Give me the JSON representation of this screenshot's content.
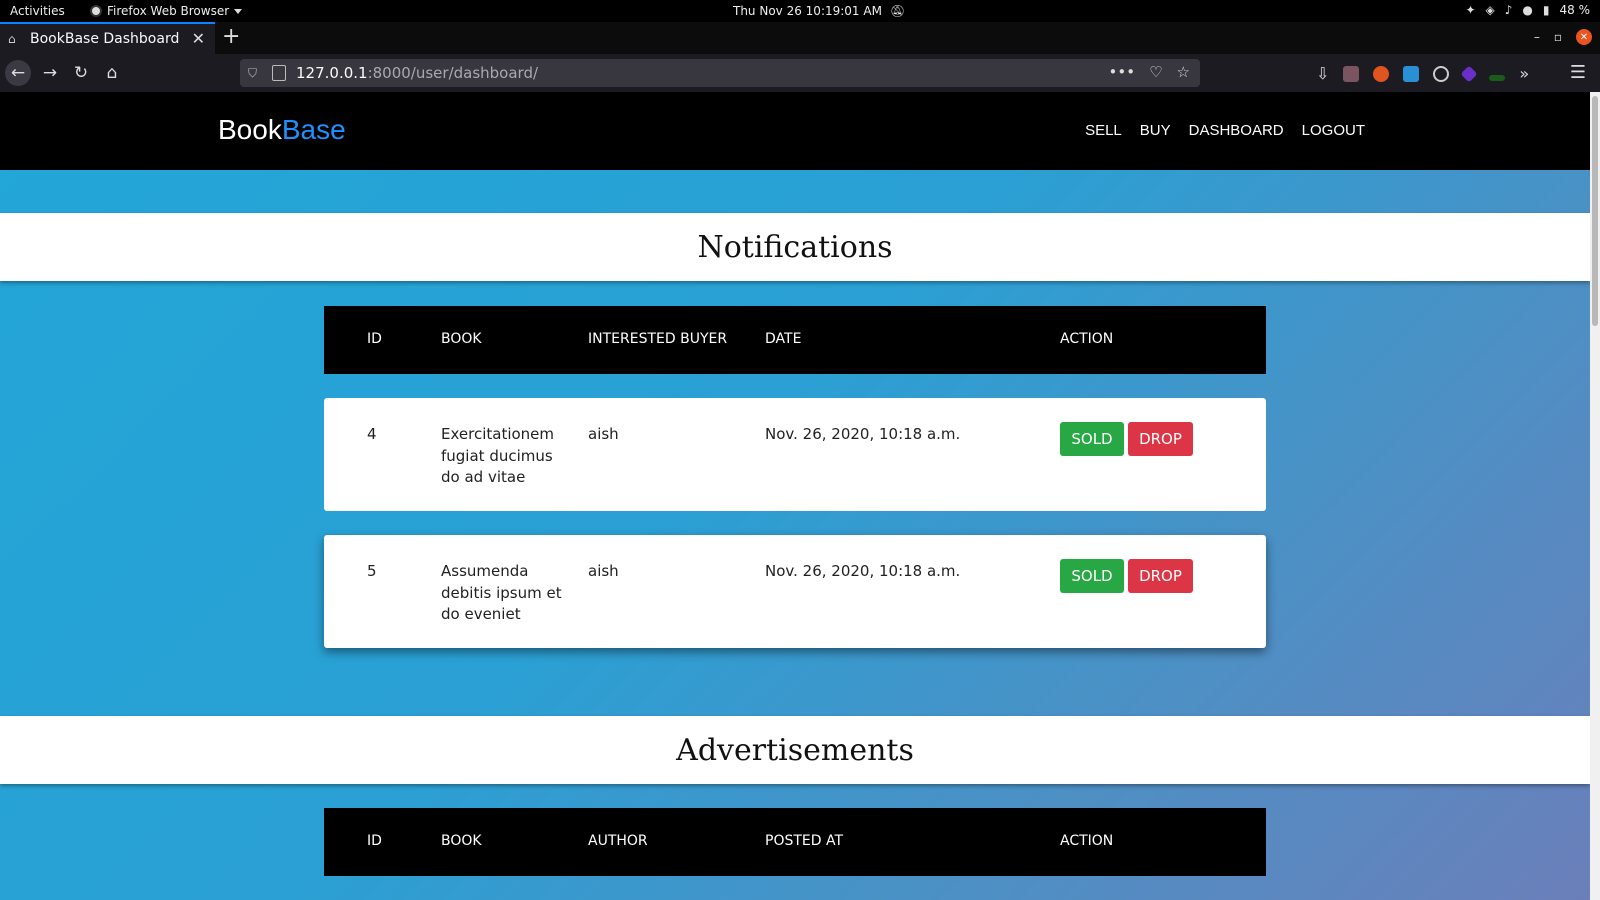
{
  "os_bar": {
    "activities": "Activities",
    "app_name": "Firefox Web Browser",
    "clock": "Thu Nov 26  10:19:01 AM",
    "battery": "48 %"
  },
  "browser": {
    "tab_title": "BookBase Dashboard",
    "url_host": "127.0.0.1",
    "url_rest": ":8000/user/dashboard/"
  },
  "site": {
    "brand_part1": "Book",
    "brand_part2": "Base",
    "brand_accent_color": "#1e90ff",
    "nav": [
      "SELL",
      "BUY",
      "DASHBOARD",
      "LOGOUT"
    ]
  },
  "notifications": {
    "title": "Notifications",
    "headers": [
      "ID",
      "BOOK",
      "INTERESTED BUYER",
      "DATE",
      "ACTION"
    ],
    "rows": [
      {
        "id": "4",
        "book": "Exercitationem fugiat ducimus do ad vitae",
        "buyer": "aish",
        "date": "Nov. 26, 2020, 10:18 a.m.",
        "sold": "SOLD",
        "drop": "DROP"
      },
      {
        "id": "5",
        "book": "Assumenda debitis ipsum et do eveniet",
        "buyer": "aish",
        "date": "Nov. 26, 2020, 10:18 a.m.",
        "sold": "SOLD",
        "drop": "DROP"
      }
    ]
  },
  "advertisements": {
    "title": "Advertisements",
    "headers": [
      "ID",
      "BOOK",
      "AUTHOR",
      "POSTED AT",
      "ACTION"
    ]
  },
  "colors": {
    "sold": "#28a745",
    "drop": "#dc3545",
    "gradient_start": "#22a6d8",
    "gradient_end": "#6b7fba"
  }
}
